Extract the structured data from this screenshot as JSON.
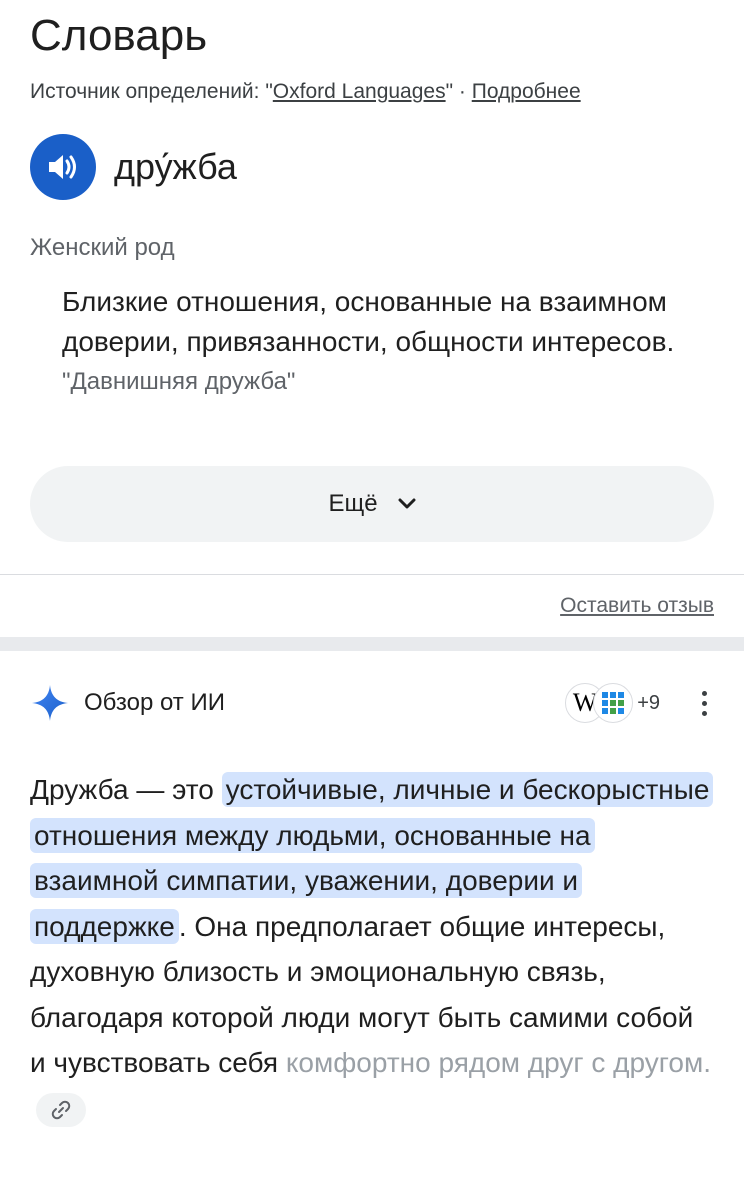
{
  "dictionary": {
    "title": "Словарь",
    "source_prefix": "Источник определений: ",
    "source_quote_open": "\"",
    "source_name": "Oxford Languages",
    "source_quote_close": "\"",
    "source_sep": " · ",
    "more_info_link": "Подробнее",
    "word": "дру́жба",
    "part_of_speech": "Женский род",
    "definition": "Близкие отношения, основанные на взаимном доверии, привязанности, общности интересов.",
    "example": "\"Давнишняя дружба\"",
    "more_button": "Ещё",
    "feedback_link": "Оставить отзыв"
  },
  "ai_overview": {
    "title": "Обзор от ИИ",
    "sources_count": "+9",
    "wiki_letter": "W",
    "text_intro": "Дружба — это ",
    "text_highlight": "устойчивые, личные и бескорыстные отношения между людьми, основанные на взаимной симпатии, уважении, доверии и поддержке",
    "text_rest": ". Она предполагает общие интересы, духовную близость и эмоциональную связь, благодаря которой люди могут быть самими собой и чувствовать себя ",
    "text_faded": "комфортно рядом друг с другом."
  },
  "icons": {
    "speaker": "speaker-icon",
    "chevron": "chevron-down-icon",
    "sparkle": "gemini-sparkle-icon",
    "link": "link-icon",
    "more": "more-vert-icon"
  },
  "colors": {
    "accent_blue": "#1a5fc8",
    "highlight": "#d3e3fd",
    "chip_bg": "#f1f3f4"
  }
}
